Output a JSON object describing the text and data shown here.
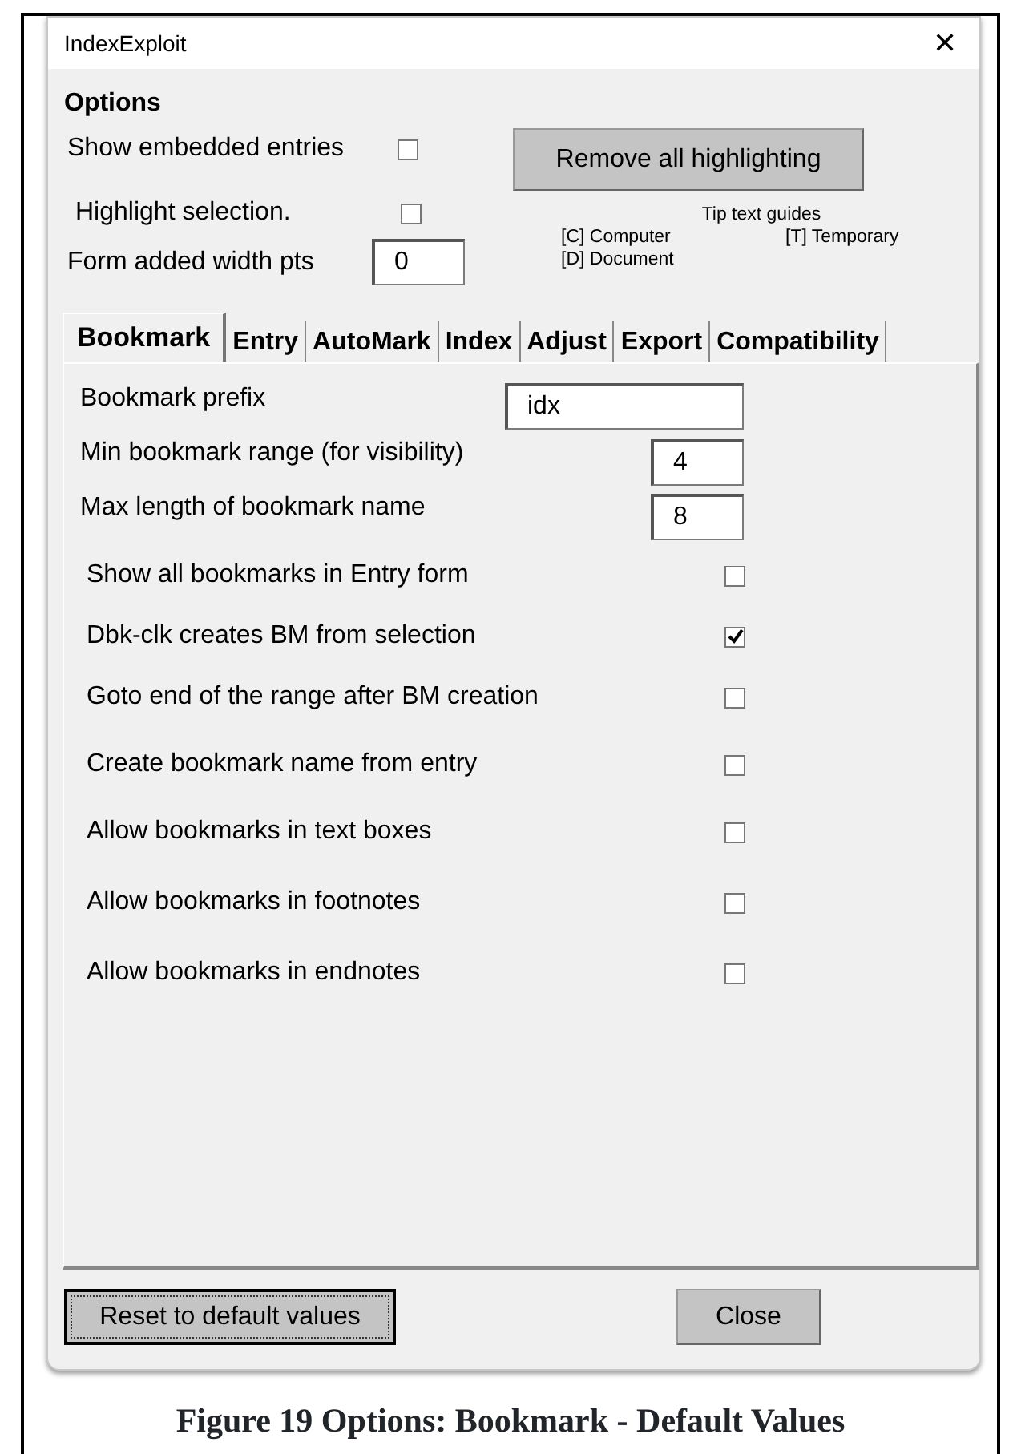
{
  "window": {
    "title": "IndexExploit",
    "close": "✕"
  },
  "options": {
    "heading": "Options",
    "top_checks": [
      {
        "label": "Show embedded entries",
        "checked": false
      },
      {
        "label": "Highlight selection.",
        "checked": false
      }
    ],
    "width_field": {
      "label": "Form added width pts",
      "value": "0"
    },
    "remove_button": "Remove all highlighting",
    "tip": {
      "title": "Tip text guides",
      "items": [
        "[C] Computer",
        "[T] Temporary",
        "[D] Document"
      ]
    }
  },
  "tabs": [
    {
      "label": "Bookmark",
      "selected": true
    },
    {
      "label": "Entry",
      "selected": false
    },
    {
      "label": "AutoMark",
      "selected": false
    },
    {
      "label": "Index",
      "selected": false
    },
    {
      "label": "Adjust",
      "selected": false
    },
    {
      "label": "Export",
      "selected": false
    },
    {
      "label": "Compatibility",
      "selected": false
    }
  ],
  "fields": [
    {
      "label": "Bookmark prefix",
      "value": "idx",
      "kind": "wide"
    },
    {
      "label": "Min bookmark range (for visibility)",
      "value": "4",
      "kind": "narrow"
    },
    {
      "label": "Max length of bookmark name",
      "value": "8",
      "kind": "narrow"
    }
  ],
  "checks": [
    {
      "label": "Show all bookmarks in Entry form",
      "checked": false
    },
    {
      "label": "Dbk-clk creates BM from selection",
      "checked": true
    },
    {
      "label": "Goto end of the range after BM creation",
      "checked": false
    },
    {
      "label": "Create bookmark name from entry",
      "checked": false
    },
    {
      "label": "Allow bookmarks in text boxes",
      "checked": false
    },
    {
      "label": "Allow bookmarks in footnotes",
      "checked": false
    },
    {
      "label": "Allow bookmarks in endnotes",
      "checked": false
    }
  ],
  "buttons": [
    {
      "label": "Reset to default values",
      "focused": true
    },
    {
      "label": "Close",
      "focused": false
    }
  ],
  "caption": "Figure 19 Options: Bookmark - Default Values"
}
